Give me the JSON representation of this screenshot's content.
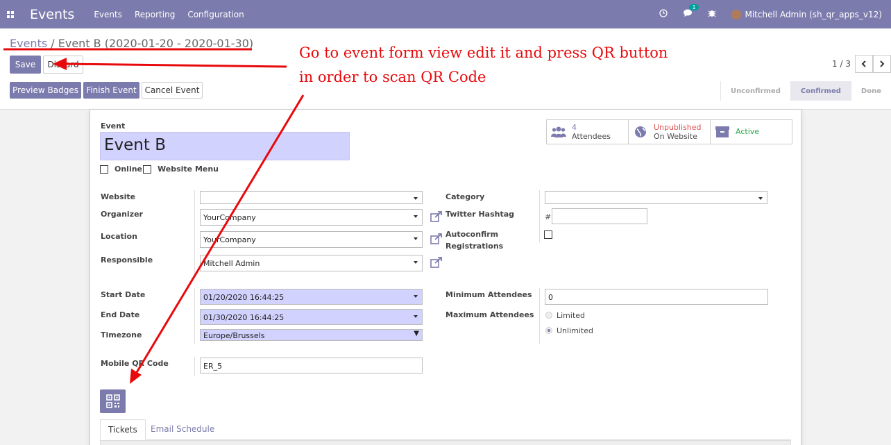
{
  "navbar": {
    "app_title": "Events",
    "menu": [
      "Events",
      "Reporting",
      "Configuration"
    ],
    "chat_badge": "1",
    "user": "Mitchell Admin (sh_qr_apps_v12)"
  },
  "breadcrumb": {
    "parent": "Events",
    "separator": "/",
    "current": "Event B (2020-01-20 - 2020-01-30)"
  },
  "actions": {
    "save": "Save",
    "discard": "Discard"
  },
  "pager": {
    "value": "1 / 3",
    "prev": "‹",
    "next": "›"
  },
  "header_buttons": {
    "preview_badges": "Preview Badges",
    "finish_event": "Finish Event",
    "cancel_event": "Cancel Event"
  },
  "statusbar": [
    "Unconfirmed",
    "Confirmed",
    "Done"
  ],
  "statusbar_active": "Confirmed",
  "form": {
    "event_label": "Event",
    "event_name": "Event B",
    "online_label": "Online",
    "website_menu_label": "Website Menu",
    "stats": {
      "attendees_count": "4",
      "attendees_label": "Attendees",
      "published_state": "Unpublished",
      "published_label": "On Website",
      "active_label": "Active"
    },
    "left_group": {
      "website_label": "Website",
      "website_value": "",
      "organizer_label": "Organizer",
      "organizer_value": "YourCompany",
      "location_label": "Location",
      "location_value": "YourCompany",
      "responsible_label": "Responsible",
      "responsible_value": "Mitchell Admin"
    },
    "right_group": {
      "category_label": "Category",
      "category_value": "",
      "twitter_label": "Twitter Hashtag",
      "twitter_prefix": "#",
      "autoconfirm_label_1": "Autoconfirm",
      "autoconfirm_label_2": "Registrations"
    },
    "dates": {
      "start_label": "Start Date",
      "start_value": "01/20/2020 16:44:25",
      "end_label": "End Date",
      "end_value": "01/30/2020 16:44:25",
      "timezone_label": "Timezone",
      "timezone_value": "Europe/Brussels"
    },
    "attendees": {
      "min_label": "Minimum Attendees",
      "min_value": "0",
      "max_label": "Maximum Attendees",
      "limited": "Limited",
      "unlimited": "Unlimited",
      "selected": "Unlimited"
    },
    "qr": {
      "label": "Mobile QR Code",
      "value": "ER_5"
    },
    "tabs": [
      "Tickets",
      "Email Schedule"
    ]
  },
  "annotation": {
    "line1": "Go to event form view edit it and press QR button",
    "line2": "in order to scan QR Code",
    "color": "#e8090c"
  },
  "colors": {
    "brand": "#7c7bad",
    "required": "#d2d2ff",
    "unpublished": "#d9534f",
    "active": "#28a745"
  }
}
